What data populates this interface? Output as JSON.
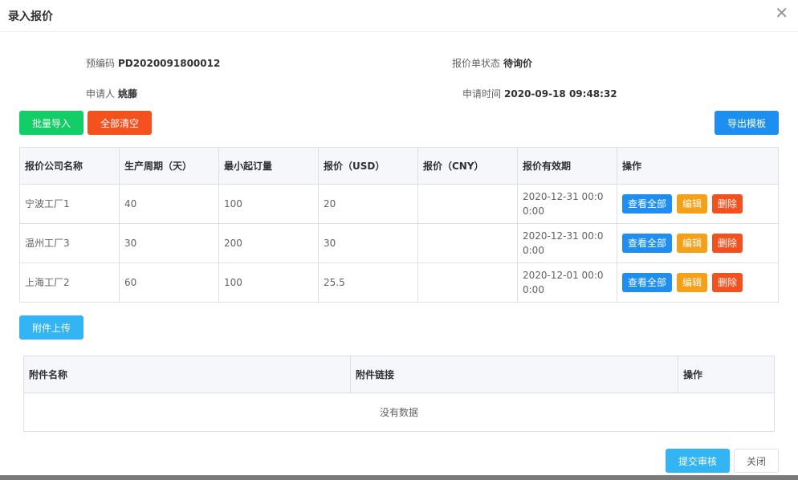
{
  "dialog": {
    "title": "录入报价"
  },
  "info": {
    "code_label": "预编码",
    "code_value": "PD2020091800012",
    "status_label": "报价单状态",
    "status_value": "待询价",
    "applicant_label": "申请人",
    "applicant_value": "姚藤",
    "time_label": "申请时间",
    "time_value": "2020-09-18 09:48:32"
  },
  "toolbar": {
    "import_label": "批量导入",
    "clear_label": "全部清空",
    "export_label": "导出模板"
  },
  "quote_table": {
    "headers": [
      "报价公司名称",
      "生产周期（天）",
      "最小起订量",
      "报价（USD）",
      "报价（CNY）",
      "报价有效期",
      "操作"
    ],
    "rows": [
      {
        "company": "宁波工厂1",
        "cycle": "40",
        "moq": "100",
        "usd": "20",
        "cny": "",
        "validity": "2020-12-31 00:00:00"
      },
      {
        "company": "温州工厂3",
        "cycle": "30",
        "moq": "200",
        "usd": "30",
        "cny": "",
        "validity": "2020-12-31 00:00:00"
      },
      {
        "company": "上海工厂2",
        "cycle": "60",
        "moq": "100",
        "usd": "25.5",
        "cny": "",
        "validity": "2020-12-01 00:00:00"
      }
    ],
    "actions": {
      "view": "查看全部",
      "edit": "编辑",
      "delete": "删除"
    }
  },
  "attachment": {
    "upload_label": "附件上传",
    "headers": [
      "附件名称",
      "附件链接",
      "操作"
    ],
    "empty_text": "没有数据"
  },
  "footer": {
    "submit_label": "提交审核",
    "close_label": "关闭"
  },
  "colors": {
    "green": "#13ce66",
    "red": "#f4511e",
    "blue": "#1e8ff0",
    "orange": "#f5a016",
    "cyan": "#33b5f5"
  }
}
